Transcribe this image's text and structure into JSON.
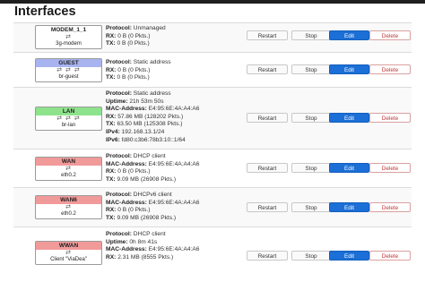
{
  "page": {
    "title": "Interfaces"
  },
  "buttons": {
    "restart": "Restart",
    "stop": "Stop",
    "edit": "Edit",
    "delete": "Delete"
  },
  "labels": {
    "protocol": "Protocol:",
    "uptime": "Uptime:",
    "mac": "MAC-Address:",
    "rx": "RX:",
    "tx": "TX:",
    "ipv4": "IPv4:",
    "ipv6": "IPv6:"
  },
  "interfaces": [
    {
      "name": "MODEM_1_1",
      "color": "#ffffff",
      "icons": "⇄",
      "device": "3g-modem",
      "protocol": "Unmanaged",
      "rx": "0 B (0 Pkts.)",
      "tx": "0 B (0 Pkts.)"
    },
    {
      "name": "GUEST",
      "color": "#a8b4f0",
      "icons": "⇄ ⇄ ⇄",
      "device": "br-guest",
      "protocol": "Static address",
      "rx": "0 B (0 Pkts.)",
      "tx": "0 B (0 Pkts.)"
    },
    {
      "name": "LAN",
      "color": "#8ee28c",
      "icons": "⇄ ⇄ ⇄",
      "device": "br-lan",
      "protocol": "Static address",
      "uptime": "21h 53m 50s",
      "mac": "E4:95:6E:4A:A4:A6",
      "rx": "57.86 MB (128202 Pkts.)",
      "tx": "63.50 MB (125308 Pkts.)",
      "ipv4": "192.168.13.1/24",
      "ipv6": "fd80:c3b6:78b3:10::1/64"
    },
    {
      "name": "WAN",
      "color": "#f19a9a",
      "icons": "⇄",
      "device": "eth0.2",
      "protocol": "DHCP client",
      "mac": "E4:95:6E:4A:A4:A6",
      "rx": "0 B (0 Pkts.)",
      "tx": "9.09 MB (26908 Pkts.)"
    },
    {
      "name": "WAN6",
      "color": "#f19a9a",
      "icons": "⇄",
      "device": "eth0.2",
      "protocol": "DHCPv6 client",
      "mac": "E4:95:6E:4A:A4:A6",
      "rx": "0 B (0 Pkts.)",
      "tx": "9.09 MB (26908 Pkts.)"
    },
    {
      "name": "WWAN",
      "color": "#f19a9a",
      "icons": "⇄",
      "device": "Client \"ViaDea\"",
      "protocol": "DHCP client",
      "uptime": "0h 8m 41s",
      "mac": "E4:95:6E:4A:A4:A6",
      "rx": "2.31 MB (8555 Pkts.)"
    }
  ]
}
